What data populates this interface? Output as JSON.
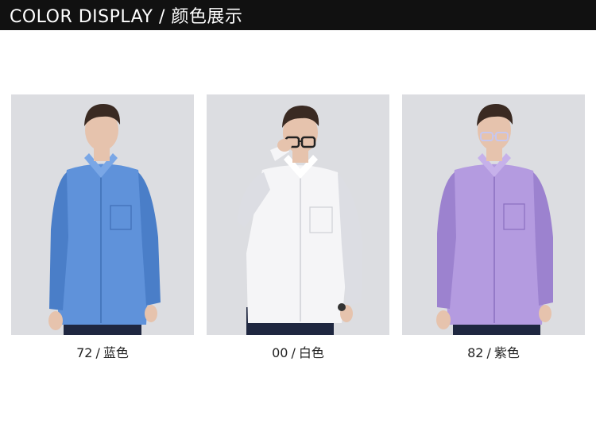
{
  "header": {
    "title": "COLOR DISPLAY / 颜色展示"
  },
  "colors": {
    "header_bg": "#111111",
    "photo_bg": "#dcdde1",
    "shirt_blue": "#5f92da",
    "shirt_white": "#f5f5f7",
    "shirt_purple": "#b49be0",
    "pants": "#1f2740",
    "hair": "#3a2a22",
    "skin": "#e6c3ad"
  },
  "products": [
    {
      "code": "72",
      "separator": "/",
      "color_name": "蓝色",
      "shirt_color": "#5f92da",
      "shirt_shade": "#4a7ec8",
      "glasses": false
    },
    {
      "code": "00",
      "separator": "/",
      "color_name": "白色",
      "shirt_color": "#f5f5f7",
      "shirt_shade": "#dcdde3",
      "glasses": true
    },
    {
      "code": "82",
      "separator": "/",
      "color_name": "紫色",
      "shirt_color": "#b49be0",
      "shirt_shade": "#9c82cf",
      "glasses": true
    }
  ]
}
